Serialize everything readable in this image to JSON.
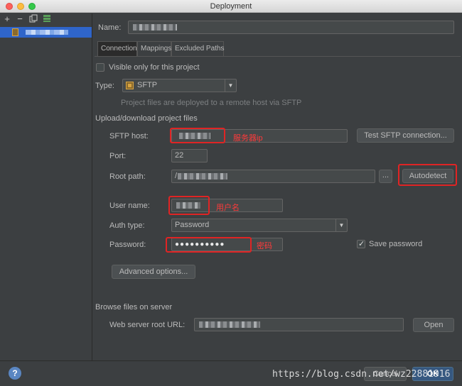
{
  "window": {
    "title": "Deployment"
  },
  "sidebar": {
    "toolbar": {
      "add": "+",
      "remove": "−"
    }
  },
  "name_label": "Name:",
  "tabs": [
    {
      "label": "Connection",
      "active": true
    },
    {
      "label": "Mappings",
      "active": false
    },
    {
      "label": "Excluded Paths",
      "active": false
    }
  ],
  "visible_only": {
    "label": "Visible only for this project",
    "checked": false
  },
  "type": {
    "label": "Type:",
    "value": "SFTP",
    "hint": "Project files are deployed to a remote host via SFTP"
  },
  "upload_section": {
    "title": "Upload/download project files"
  },
  "sftp_host": {
    "label": "SFTP host:",
    "annotation": "服务器ip",
    "test_button": "Test SFTP connection..."
  },
  "port": {
    "label": "Port:",
    "value": "22"
  },
  "root_path": {
    "label": "Root path:",
    "value": "/",
    "browse": "...",
    "autodetect": "Autodetect"
  },
  "user_name": {
    "label": "User name:",
    "annotation": "用户名"
  },
  "auth_type": {
    "label": "Auth type:",
    "value": "Password"
  },
  "password": {
    "label": "Password:",
    "dots": "●●●●●●●●●●",
    "annotation": "密码",
    "save_label": "Save password",
    "save_checked": true
  },
  "advanced": {
    "label": "Advanced options..."
  },
  "browse_section": {
    "title": "Browse files on server",
    "web_root_label": "Web server root URL:",
    "open_button": "Open"
  },
  "footer": {
    "help": "?",
    "watermark": "https://blog.csdn.net/wz22881916",
    "cancel": "Cancel",
    "ok": "OK"
  },
  "colors": {
    "background": "#3c3f41",
    "selection": "#2f65ca",
    "annotation": "#e02424",
    "ok_button": "#365880"
  }
}
